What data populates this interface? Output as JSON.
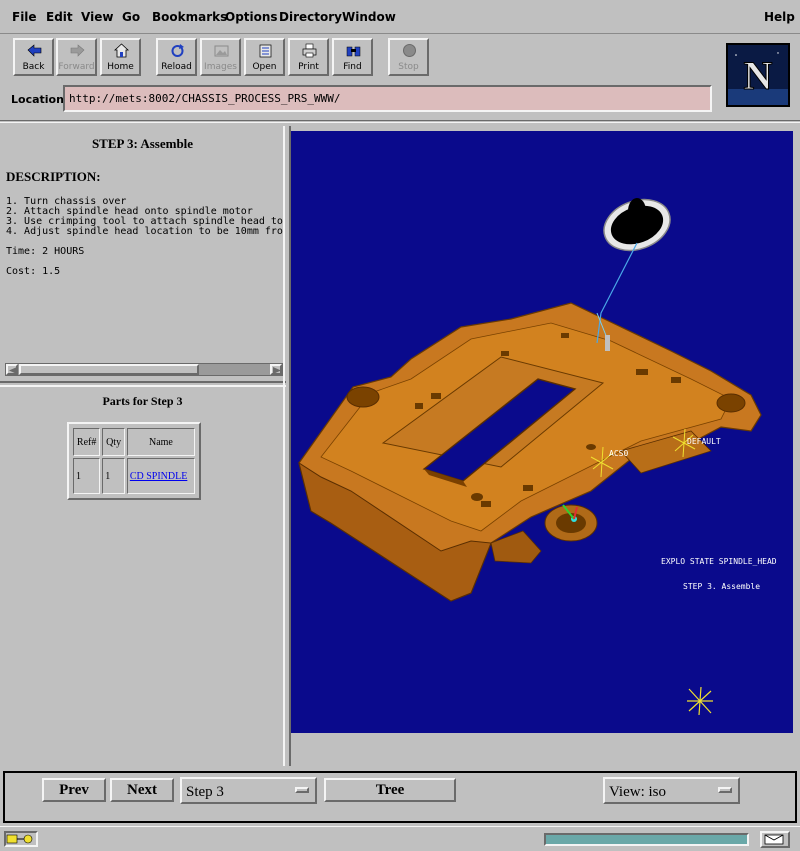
{
  "menu": {
    "items": [
      "File",
      "Edit",
      "View",
      "Go",
      "Bookmarks",
      "Options",
      "Directory",
      "Window"
    ],
    "help": "Help"
  },
  "toolbar": {
    "buttons": [
      {
        "label": "Back",
        "icon": "back-arrow-icon",
        "enabled": true
      },
      {
        "label": "Forward",
        "icon": "forward-arrow-icon",
        "enabled": false
      },
      {
        "label": "Home",
        "icon": "home-icon",
        "enabled": true
      },
      {
        "label": "Reload",
        "icon": "reload-icon",
        "enabled": true
      },
      {
        "label": "Images",
        "icon": "images-icon",
        "enabled": false
      },
      {
        "label": "Open",
        "icon": "open-icon",
        "enabled": true
      },
      {
        "label": "Print",
        "icon": "print-icon",
        "enabled": true
      },
      {
        "label": "Find",
        "icon": "find-icon",
        "enabled": true
      },
      {
        "label": "Stop",
        "icon": "stop-icon",
        "enabled": false
      }
    ],
    "logo_letter": "N"
  },
  "location": {
    "label": "Location:",
    "url": "http://mets:8002/CHASSIS_PROCESS_PRS_WWW/"
  },
  "step": {
    "title": "STEP 3: Assemble",
    "description_heading": "DESCRIPTION:",
    "lines": [
      "1. Turn chassis over",
      "2. Attach spindle head onto spindle motor",
      "3. Use crimping tool to attach spindle head to",
      "4. Adjust spindle head location to be 10mm fro"
    ],
    "time": "Time:  2 HOURS",
    "cost": "Cost:  1.5"
  },
  "parts": {
    "title": "Parts for Step 3",
    "headers": [
      "Ref#",
      "Qty",
      "Name"
    ],
    "rows": [
      {
        "ref": "1",
        "qty": "1",
        "name": "CD SPINDLE"
      }
    ]
  },
  "viewport": {
    "labels": {
      "acs0": "ACS0",
      "default": "DEFAULT",
      "explo": "EXPLO STATE  SPINDLE_HEAD",
      "step": "STEP 3. Assemble"
    },
    "colors": {
      "background": "#0a0a8c",
      "part": "#c87820"
    }
  },
  "controls": {
    "prev": "Prev",
    "next": "Next",
    "step_select": "Step 3",
    "tree": "Tree",
    "view_select": "View: iso"
  }
}
